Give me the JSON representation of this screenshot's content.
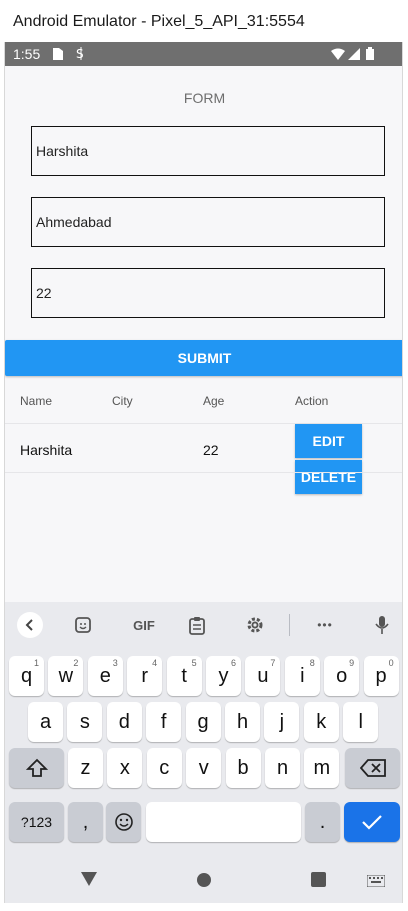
{
  "window": {
    "title": "Android Emulator - Pixel_5_API_31:5554"
  },
  "status_bar": {
    "time": "1:55"
  },
  "form": {
    "title": "FORM",
    "fields": [
      {
        "name": "name-field",
        "value": "Harshita"
      },
      {
        "name": "city-field",
        "value": "Ahmedabad"
      },
      {
        "name": "age-field",
        "value": "22"
      }
    ],
    "submit_label": "SUBMIT"
  },
  "table": {
    "headers": [
      "Name",
      "City",
      "Age",
      "Action"
    ],
    "rows": [
      {
        "name": "Harshita",
        "city": "",
        "age": "22"
      }
    ],
    "edit_label": "EDIT",
    "delete_label": "DELETE"
  },
  "keyboard": {
    "toolbar": {
      "gif_label": "GIF",
      "more_label": "•••"
    },
    "row1": [
      {
        "k": "q",
        "h": "1"
      },
      {
        "k": "w",
        "h": "2"
      },
      {
        "k": "e",
        "h": "3"
      },
      {
        "k": "r",
        "h": "4"
      },
      {
        "k": "t",
        "h": "5"
      },
      {
        "k": "y",
        "h": "6"
      },
      {
        "k": "u",
        "h": "7"
      },
      {
        "k": "i",
        "h": "8"
      },
      {
        "k": "o",
        "h": "9"
      },
      {
        "k": "p",
        "h": "0"
      }
    ],
    "row2": [
      "a",
      "s",
      "d",
      "f",
      "g",
      "h",
      "j",
      "k",
      "l"
    ],
    "row3": [
      "z",
      "x",
      "c",
      "v",
      "b",
      "n",
      "m"
    ],
    "symbols_label": "?123",
    "comma_label": ",",
    "period_label": "."
  },
  "colors": {
    "accent": "#2196f3",
    "status_bar": "#6f6f6f",
    "keyboard_bg": "#e9eaee"
  }
}
